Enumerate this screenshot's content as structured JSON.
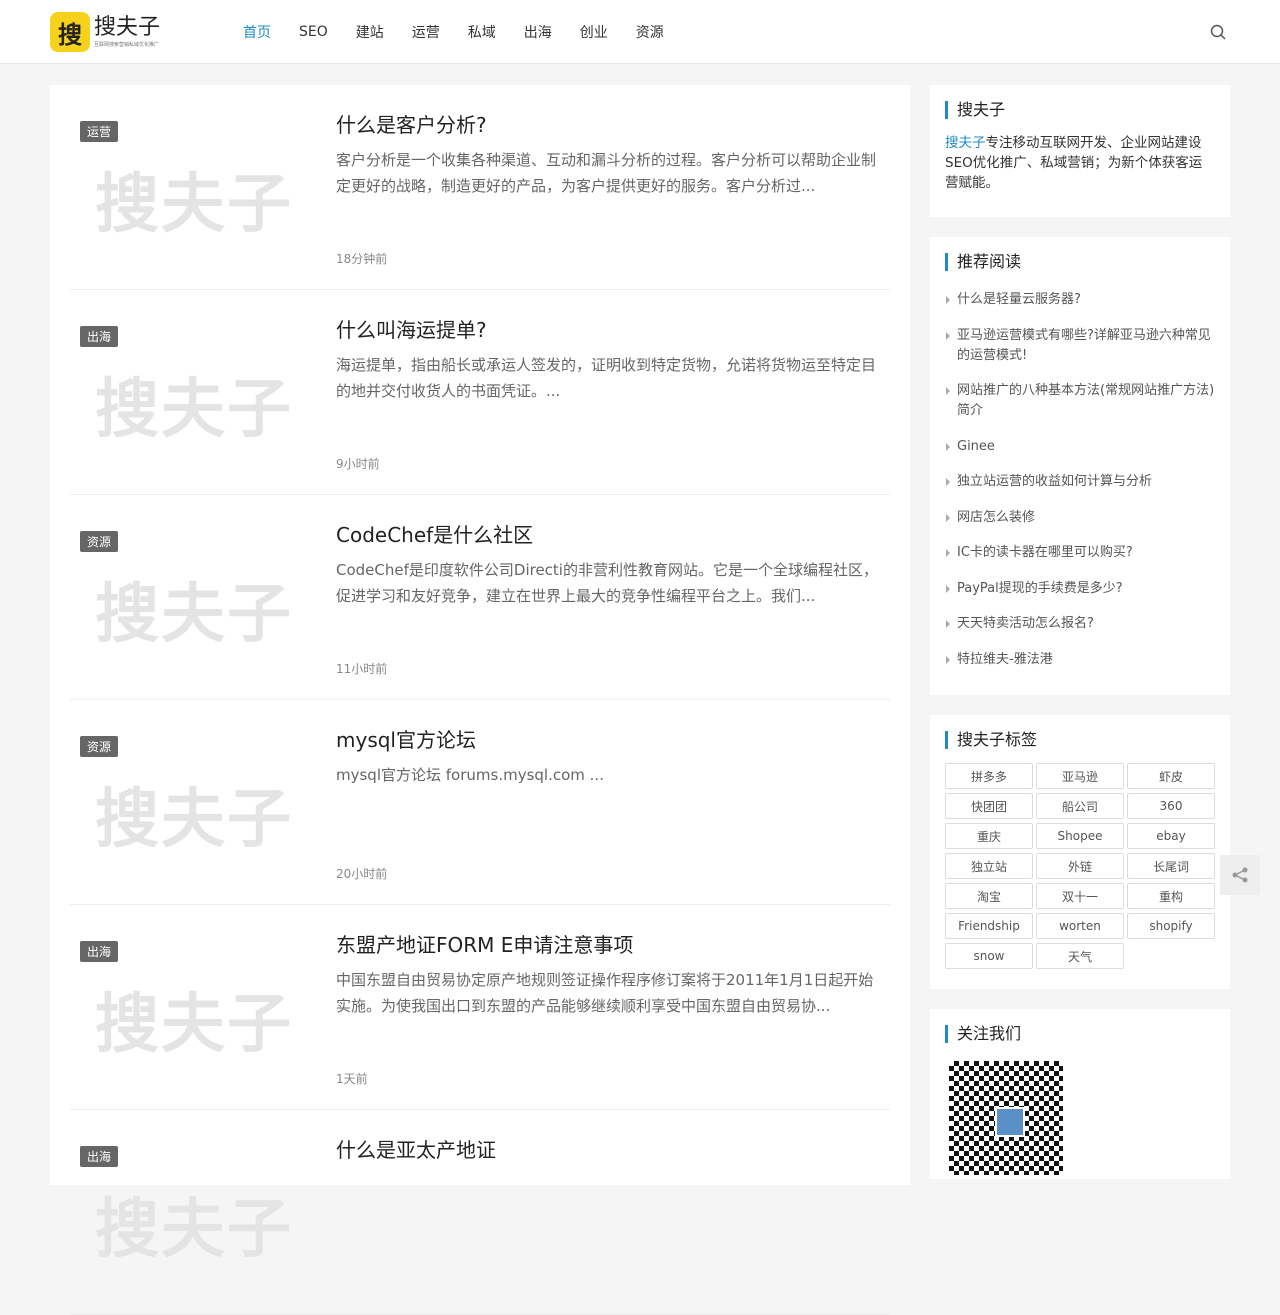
{
  "header": {
    "logo_char": "搜",
    "logo_name": "搜夫子",
    "logo_sub": "互联网搜索营销私域优化推广",
    "nav": [
      "首页",
      "SEO",
      "建站",
      "运营",
      "私域",
      "出海",
      "创业",
      "资源"
    ]
  },
  "watermark": "搜夫子",
  "posts": [
    {
      "cat": "运营",
      "title": "什么是客户分析?",
      "excerpt": "客户分析是一个收集各种渠道、互动和漏斗分析的过程。客户分析可以帮助企业制定更好的战略，制造更好的产品，为客户提供更好的服务。客户分析过...",
      "time": "18分钟前"
    },
    {
      "cat": "出海",
      "title": "什么叫海运提单?",
      "excerpt": "海运提单，指由船长或承运人签发的，证明收到特定货物，允诺将货物运至特定目的地并交付收货人的书面凭证。...",
      "time": "9小时前"
    },
    {
      "cat": "资源",
      "title": "CodeChef是什么社区",
      "excerpt": "CodeChef是印度软件公司Directi的非营利性教育网站。它是一个全球编程社区，促进学习和友好竞争，建立在世界上最大的竞争性编程平台之上。我们...",
      "time": "11小时前"
    },
    {
      "cat": "资源",
      "title": "mysql官方论坛",
      "excerpt": "mysql官方论坛 forums.mysql.com ...",
      "time": "20小时前"
    },
    {
      "cat": "出海",
      "title": "东盟产地证FORM E申请注意事项",
      "excerpt": "中国东盟自由贸易协定原产地规则签证操作程序修订案将于2011年1月1日起开始实施。为使我国出口到东盟的产品能够继续顺利享受中国东盟自由贸易协...",
      "time": "1天前"
    },
    {
      "cat": "出海",
      "title": "什么是亚太产地证",
      "excerpt": "",
      "time": ""
    }
  ],
  "sidebar": {
    "about_title": "搜夫子",
    "about_link": "搜夫子",
    "about_text": "专注移动互联网开发、企业网站建设SEO优化推广、私域营销；为新个体获客运营赋能。",
    "rec_title": "推荐阅读",
    "rec": [
      "什么是轻量云服务器?",
      "亚马逊运营模式有哪些?详解亚马逊六种常见的运营模式!",
      "网站推广的八种基本方法(常规网站推广方法)简介",
      "Ginee",
      "独立站运营的收益如何计算与分析",
      "网店怎么装修",
      "IC卡的读卡器在哪里可以购买?",
      "PayPal提现的手续费是多少?",
      "天天特卖活动怎么报名?",
      "特拉维夫-雅法港"
    ],
    "tags_title": "搜夫子标签",
    "tags": [
      "拼多多",
      "亚马逊",
      "虾皮",
      "快团团",
      "船公司",
      "360",
      "重庆",
      "Shopee",
      "ebay",
      "独立站",
      "外链",
      "长尾词",
      "淘宝",
      "双十一",
      "重构",
      "Friendship",
      "worten",
      "shopify",
      "snow",
      "天气"
    ],
    "follow_title": "关注我们"
  }
}
